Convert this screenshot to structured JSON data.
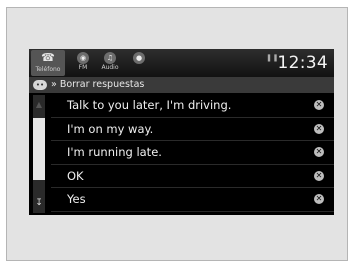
{
  "tabs": [
    {
      "label": "Teléfono",
      "icon": "phone-icon",
      "glyph": "☎"
    },
    {
      "label": "FM",
      "icon": "radio-icon",
      "glyph": "◉"
    },
    {
      "label": "Audio",
      "icon": "audio-icon",
      "glyph": "♫"
    },
    {
      "label": "",
      "icon": "extra-icon",
      "glyph": "●"
    }
  ],
  "status": {
    "text": "▐ ▐ °ⁿ"
  },
  "clock": "12:34",
  "header": {
    "title": "» Borrar respuestas",
    "icon": "message-icon"
  },
  "responses": [
    {
      "text": "Talk to you later, I'm driving."
    },
    {
      "text": "I'm on my way."
    },
    {
      "text": "I'm running late."
    },
    {
      "text": "OK"
    },
    {
      "text": "Yes"
    }
  ],
  "delete_glyph": "✕"
}
